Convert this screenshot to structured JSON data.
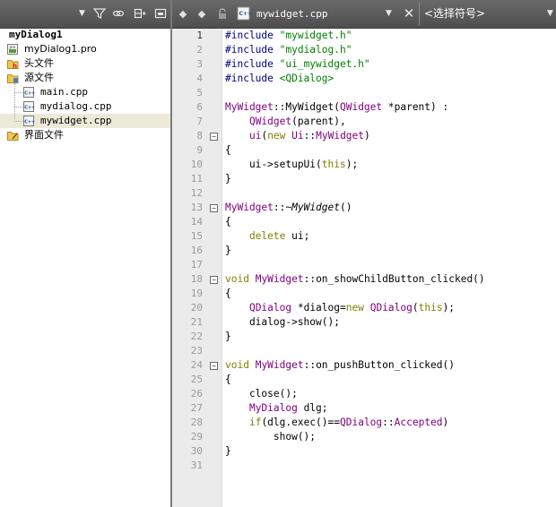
{
  "colors": {
    "toolbar_bg": "#585858",
    "gutter_bg": "#ebebeb",
    "keyword": "#808000",
    "type": "#800080",
    "string": "#008000",
    "preprocessor": "#000080",
    "selected_row": "#ece9d8"
  },
  "project_tree": [
    {
      "label": "myDialog1",
      "icon": "qt-project-icon",
      "level": 0,
      "bold": true,
      "selected": false
    },
    {
      "label": "myDialog1.pro",
      "icon": "pro-file-icon",
      "level": 1,
      "bold": false,
      "selected": false
    },
    {
      "label": "头文件",
      "icon": "header-folder-icon",
      "level": 1,
      "bold": false,
      "selected": false
    },
    {
      "label": "源文件",
      "icon": "source-folder-icon",
      "level": 1,
      "bold": false,
      "selected": false
    },
    {
      "label": "main.cpp",
      "icon": "cpp-file-icon",
      "level": 2,
      "bold": false,
      "selected": false
    },
    {
      "label": "mydialog.cpp",
      "icon": "cpp-file-icon",
      "level": 2,
      "bold": false,
      "selected": false
    },
    {
      "label": "mywidget.cpp",
      "icon": "cpp-file-icon",
      "level": 2,
      "bold": false,
      "selected": true
    },
    {
      "label": "界面文件",
      "icon": "forms-folder-icon",
      "level": 1,
      "bold": false,
      "selected": false
    }
  ],
  "editor_toolbar": {
    "file_name": "mywidget.cpp",
    "symbols_placeholder": "<选择符号>"
  },
  "editor": {
    "current_line": 1,
    "fold_lines": [
      8,
      13,
      18,
      24
    ],
    "lines": [
      [
        {
          "t": "#include ",
          "c": "pp"
        },
        {
          "t": "\"mywidget.h\"",
          "c": "str"
        }
      ],
      [
        {
          "t": "#include ",
          "c": "pp"
        },
        {
          "t": "\"mydialog.h\"",
          "c": "str"
        }
      ],
      [
        {
          "t": "#include ",
          "c": "pp"
        },
        {
          "t": "\"ui_mywidget.h\"",
          "c": "str"
        }
      ],
      [
        {
          "t": "#include ",
          "c": "pp"
        },
        {
          "t": "<QDialog>",
          "c": "str"
        }
      ],
      [],
      [
        {
          "t": "MyWidget",
          "c": "ty"
        },
        {
          "t": "::MyWidget(",
          "c": ""
        },
        {
          "t": "QWidget",
          "c": "ty"
        },
        {
          "t": " *parent) :",
          "c": ""
        }
      ],
      [
        {
          "t": "    ",
          "c": ""
        },
        {
          "t": "QWidget",
          "c": "ty"
        },
        {
          "t": "(parent),",
          "c": ""
        }
      ],
      [
        {
          "t": "    ",
          "c": ""
        },
        {
          "t": "ui",
          "c": "ty"
        },
        {
          "t": "(",
          "c": ""
        },
        {
          "t": "new",
          "c": "kw"
        },
        {
          "t": " ",
          "c": ""
        },
        {
          "t": "Ui",
          "c": "ty"
        },
        {
          "t": "::",
          "c": ""
        },
        {
          "t": "MyWidget",
          "c": "ty"
        },
        {
          "t": ")",
          "c": ""
        }
      ],
      [
        {
          "t": "{",
          "c": ""
        }
      ],
      [
        {
          "t": "    ui->setupUi(",
          "c": ""
        },
        {
          "t": "this",
          "c": "kw"
        },
        {
          "t": ");",
          "c": ""
        }
      ],
      [
        {
          "t": "}",
          "c": ""
        }
      ],
      [],
      [
        {
          "t": "MyWidget",
          "c": "ty"
        },
        {
          "t": "::~",
          "c": ""
        },
        {
          "t": "MyWidget",
          "c": "it"
        },
        {
          "t": "()",
          "c": ""
        }
      ],
      [
        {
          "t": "{",
          "c": ""
        }
      ],
      [
        {
          "t": "    ",
          "c": ""
        },
        {
          "t": "delete",
          "c": "kw"
        },
        {
          "t": " ui;",
          "c": ""
        }
      ],
      [
        {
          "t": "}",
          "c": ""
        }
      ],
      [],
      [
        {
          "t": "void",
          "c": "kw"
        },
        {
          "t": " ",
          "c": ""
        },
        {
          "t": "MyWidget",
          "c": "ty"
        },
        {
          "t": "::on_showChildButton_clicked()",
          "c": ""
        }
      ],
      [
        {
          "t": "{",
          "c": ""
        }
      ],
      [
        {
          "t": "    ",
          "c": ""
        },
        {
          "t": "QDialog",
          "c": "ty"
        },
        {
          "t": " *dialog=",
          "c": ""
        },
        {
          "t": "new",
          "c": "kw"
        },
        {
          "t": " ",
          "c": ""
        },
        {
          "t": "QDialog",
          "c": "ty"
        },
        {
          "t": "(",
          "c": ""
        },
        {
          "t": "this",
          "c": "kw"
        },
        {
          "t": ");",
          "c": ""
        }
      ],
      [
        {
          "t": "    dialog->show();",
          "c": ""
        }
      ],
      [
        {
          "t": "}",
          "c": ""
        }
      ],
      [],
      [
        {
          "t": "void",
          "c": "kw"
        },
        {
          "t": " ",
          "c": ""
        },
        {
          "t": "MyWidget",
          "c": "ty"
        },
        {
          "t": "::on_pushButton_clicked()",
          "c": ""
        }
      ],
      [
        {
          "t": "{",
          "c": ""
        }
      ],
      [
        {
          "t": "    close();",
          "c": ""
        }
      ],
      [
        {
          "t": "    ",
          "c": ""
        },
        {
          "t": "MyDialog",
          "c": "ty"
        },
        {
          "t": " dlg;",
          "c": ""
        }
      ],
      [
        {
          "t": "    ",
          "c": ""
        },
        {
          "t": "if",
          "c": "kw"
        },
        {
          "t": "(dlg.exec()==",
          "c": ""
        },
        {
          "t": "QDialog",
          "c": "ty"
        },
        {
          "t": "::",
          "c": ""
        },
        {
          "t": "Accepted",
          "c": "ty"
        },
        {
          "t": ")",
          "c": ""
        }
      ],
      [
        {
          "t": "        show();",
          "c": ""
        }
      ],
      [
        {
          "t": "}",
          "c": ""
        }
      ],
      []
    ]
  }
}
